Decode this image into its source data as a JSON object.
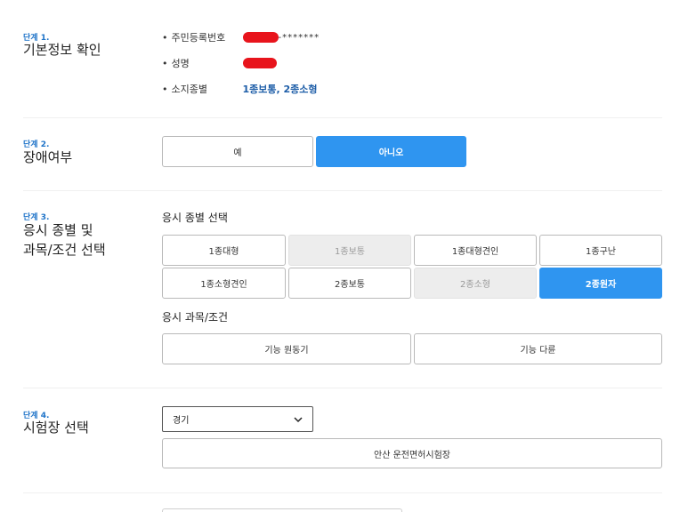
{
  "step1": {
    "label": "단계 1.",
    "title": "기본정보 확인",
    "rows": [
      {
        "key": "주민등록번호",
        "value": "-*******"
      },
      {
        "key": "성명",
        "value": ""
      },
      {
        "key": "소지종별",
        "value": "1종보통, 2종소형"
      }
    ],
    "bullet": "•"
  },
  "step2": {
    "label": "단계 2.",
    "title": "장애여부",
    "options": [
      "예",
      "아니오"
    ],
    "selected": "아니오"
  },
  "step3": {
    "label": "단계 3.",
    "title_line1": "응시 종별 및",
    "title_line2": "과목/조건 선택",
    "license_heading": "응시 종별 선택",
    "license_types": [
      {
        "label": "1종대형",
        "state": "normal"
      },
      {
        "label": "1종보통",
        "state": "disabled"
      },
      {
        "label": "1종대형견인",
        "state": "normal"
      },
      {
        "label": "1종구난",
        "state": "normal"
      },
      {
        "label": "1종소형견인",
        "state": "normal"
      },
      {
        "label": "2종보통",
        "state": "normal"
      },
      {
        "label": "2종소형",
        "state": "disabled"
      },
      {
        "label": "2종원자",
        "state": "selected"
      }
    ],
    "subject_heading": "응시 과목/조건",
    "subjects": [
      "기능 원동기",
      "기능 다륜"
    ]
  },
  "step4": {
    "label": "단계 4.",
    "title": "시험장 선택",
    "region": "경기",
    "test_center": "안산 운전면허시험장"
  },
  "colors": {
    "accent": "#2f95f0",
    "step_label": "#1e73c8",
    "redaction": "#e8141c",
    "disabled_bg": "#ededed"
  }
}
